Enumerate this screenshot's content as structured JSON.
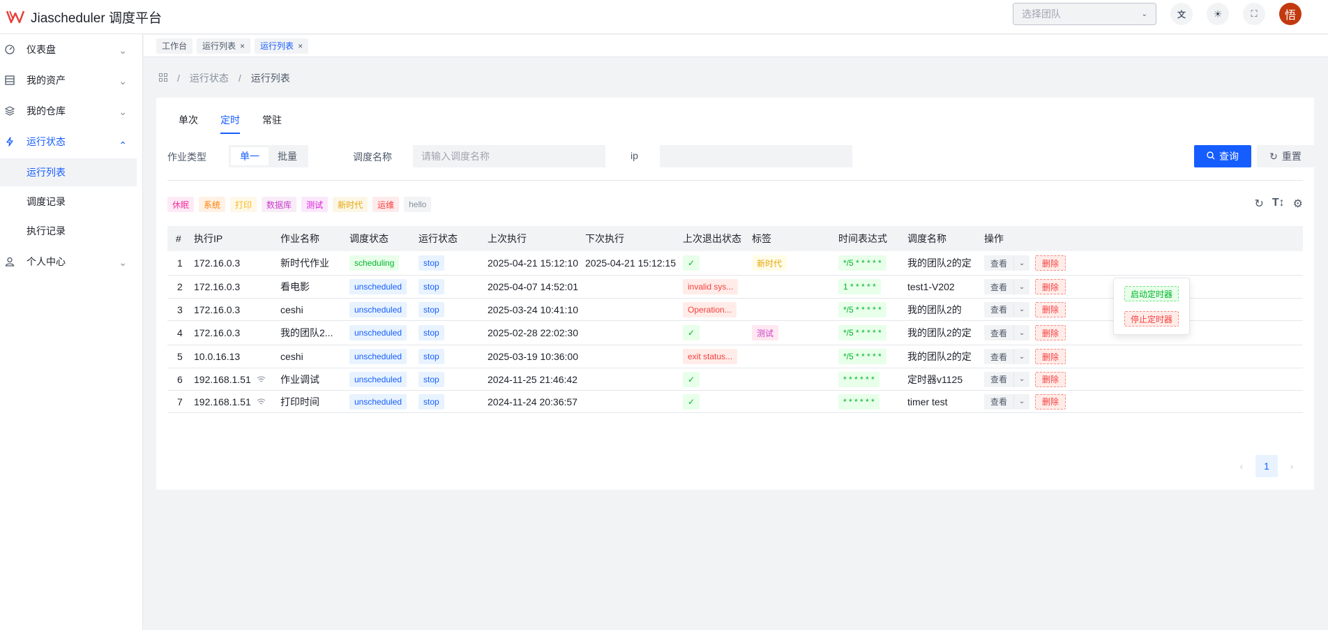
{
  "app": {
    "title": "Jiascheduler 调度平台",
    "avatar_char": "悟",
    "team_placeholder": "选择团队",
    "accent": "#165dff",
    "avatar_color": "#c2390f"
  },
  "sidebar": {
    "items": [
      {
        "label": "仪表盘",
        "icon": "dashboard-icon"
      },
      {
        "label": "我的资产",
        "icon": "asset-icon"
      },
      {
        "label": "我的仓库",
        "icon": "layers-icon"
      },
      {
        "label": "运行状态",
        "icon": "lightning-icon"
      }
    ],
    "sub_items": [
      "运行列表",
      "调度记录",
      "执行记录"
    ],
    "personal": "个人中心"
  },
  "page_tabs": [
    {
      "label": "工作台"
    },
    {
      "label": "运行列表"
    },
    {
      "label": "运行列表"
    }
  ],
  "breadcrumb": {
    "level1": "运行状态",
    "level2": "运行列表"
  },
  "sub_tabs": [
    "单次",
    "定时",
    "常驻"
  ],
  "filter": {
    "job_type_label": "作业类型",
    "job_type_options": [
      "单一",
      "批量"
    ],
    "schedule_name_label": "调度名称",
    "schedule_name_placeholder": "请输入调度名称",
    "ip_label": "ip",
    "query_label": "查询",
    "reset_label": "重置"
  },
  "tags": [
    {
      "label": "休眠",
      "color": "#f5319d"
    },
    {
      "label": "系统",
      "color": "#ff7d00"
    },
    {
      "label": "打印",
      "color": "#f7ba1e"
    },
    {
      "label": "数据库",
      "color": "#c940c9"
    },
    {
      "label": "测试",
      "color": "#d91ad9"
    },
    {
      "label": "新时代",
      "color": "#e5a70b"
    },
    {
      "label": "运维",
      "color": "#f53f3f"
    },
    {
      "label": "hello",
      "color": "#86909c"
    }
  ],
  "table": {
    "columns": [
      "#",
      "执行IP",
      "作业名称",
      "调度状态",
      "运行状态",
      "上次执行",
      "下次执行",
      "上次退出状态",
      "标签",
      "时间表达式",
      "调度名称",
      "操作"
    ],
    "view_label": "查看",
    "delete_label": "删除",
    "ok_mark": "✓",
    "rows": [
      {
        "no": "1",
        "ip": "172.16.0.3",
        "job": "新时代作业",
        "sched": "scheduling",
        "run": "stop",
        "last": "2025-04-21 15:12:10",
        "next": "2025-04-21 15:12:15",
        "exit": "ok",
        "tag": "新时代",
        "cron": "*/5 * * * * *",
        "name": "我的团队2的定"
      },
      {
        "no": "2",
        "ip": "172.16.0.3",
        "job": "看电影",
        "sched": "unscheduled",
        "run": "stop",
        "last": "2025-04-07 14:52:01",
        "next": "",
        "exit": "invalid sys...",
        "tag": "",
        "cron": "1 * * * * *",
        "name": "test1-V202"
      },
      {
        "no": "3",
        "ip": "172.16.0.3",
        "job": "ceshi",
        "sched": "unscheduled",
        "run": "stop",
        "last": "2025-03-24 10:41:10",
        "next": "",
        "exit": "Operation...",
        "tag": "",
        "cron": "*/5 * * * * *",
        "name": "我的团队2的"
      },
      {
        "no": "4",
        "ip": "172.16.0.3",
        "job": "我的团队2...",
        "sched": "unscheduled",
        "run": "stop",
        "last": "2025-02-28 22:02:30",
        "next": "",
        "exit": "ok",
        "tag": "测试",
        "cron": "*/5 * * * * *",
        "name": "我的团队2的定"
      },
      {
        "no": "5",
        "ip": "10.0.16.13",
        "job": "ceshi",
        "sched": "unscheduled",
        "run": "stop",
        "last": "2025-03-19 10:36:00",
        "next": "",
        "exit": "exit status...",
        "tag": "",
        "cron": "*/5 * * * * *",
        "name": "我的团队2的定"
      },
      {
        "no": "6",
        "ip": "192.168.1.51",
        "job": "作业调试",
        "sched": "unscheduled",
        "run": "stop",
        "last": "2024-11-25 21:46:42",
        "next": "",
        "exit": "ok",
        "tag": "",
        "cron": "* * * * * *",
        "name": "定时器v1125",
        "wifi": true
      },
      {
        "no": "7",
        "ip": "192.168.1.51",
        "job": "打印时间",
        "sched": "unscheduled",
        "run": "stop",
        "last": "2024-11-24 20:36:57",
        "next": "",
        "exit": "ok",
        "tag": "",
        "cron": "* * * * * *",
        "name": "timer test",
        "wifi": true
      }
    ]
  },
  "dropdown": {
    "start_label": "启动定时器",
    "stop_label": "停止定时器"
  },
  "pagination": {
    "current": "1"
  }
}
